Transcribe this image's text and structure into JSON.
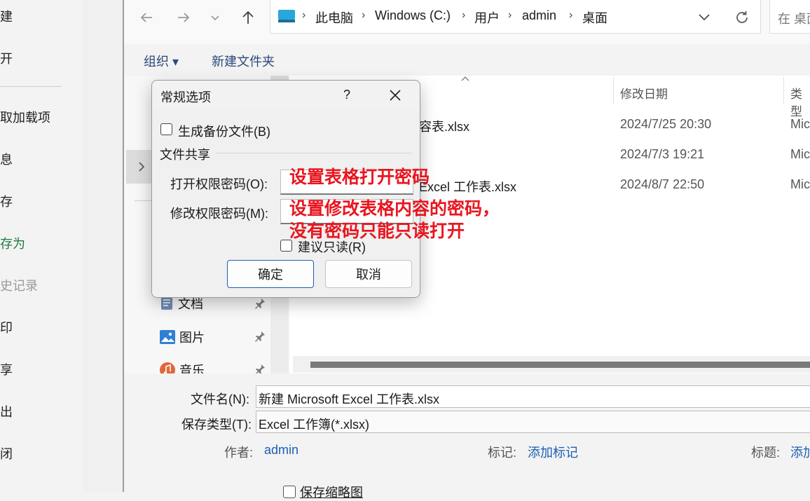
{
  "backstage": {
    "items": [
      "建",
      "开",
      "取加载项",
      "息",
      "存",
      "存为",
      "史记录",
      "印",
      "享",
      "出",
      "闭"
    ]
  },
  "nav": {
    "back_icon": "arrow-left-icon",
    "forward_icon": "arrow-right-icon",
    "recent_icon": "chevron-down-icon",
    "up_icon": "arrow-up-icon"
  },
  "address": {
    "crumbs": [
      "此电脑",
      "Windows (C:)",
      "用户",
      "admin",
      "桌面"
    ],
    "search_placeholder": "在 桌面"
  },
  "command_bar": {
    "organize": "组织 ▾",
    "new_folder": "新建文件夹"
  },
  "nav_pane": {
    "items": [
      {
        "label": "文档",
        "icon": "document-icon"
      },
      {
        "label": "图片",
        "icon": "picture-icon"
      },
      {
        "label": "音乐",
        "icon": "music-icon"
      }
    ]
  },
  "file_list": {
    "columns": {
      "date": "修改日期",
      "type": "类型"
    },
    "rows": [
      {
        "name": "容表.xlsx",
        "date": "2024/7/25 20:30",
        "type": "Mic"
      },
      {
        "name": "",
        "date": "2024/7/3 19:21",
        "type": "Mic"
      },
      {
        "name": "Excel 工作表.xlsx",
        "date": "2024/8/7 22:50",
        "type": "Mic"
      }
    ]
  },
  "form": {
    "filename_label": "文件名(N):",
    "filename_value": "新建 Microsoft Excel 工作表.xlsx",
    "savetype_label": "保存类型(T):",
    "savetype_value": "Excel 工作簿(*.xlsx)",
    "author_label": "作者:",
    "author_value": "admin",
    "tags_label": "标记:",
    "tags_value": "添加标记",
    "title_label": "标题:",
    "title_value": "添加",
    "thumbnail_label": "保存缩略图"
  },
  "dialog": {
    "title": "常规选项",
    "help": "?",
    "backup_label": "生成备份文件(B)",
    "section_label": "文件共享",
    "open_pw_label": "打开权限密码(O):",
    "modify_pw_label": "修改权限密码(M):",
    "readonly_label": "建议只读(R)",
    "ok": "确定",
    "cancel": "取消"
  },
  "annotations": {
    "open_note": "设置表格打开密码",
    "modify_note_line1": "设置修改表格内容的密码，",
    "modify_note_line2": "没有密码只能只读打开",
    "color": "#e8161f"
  }
}
